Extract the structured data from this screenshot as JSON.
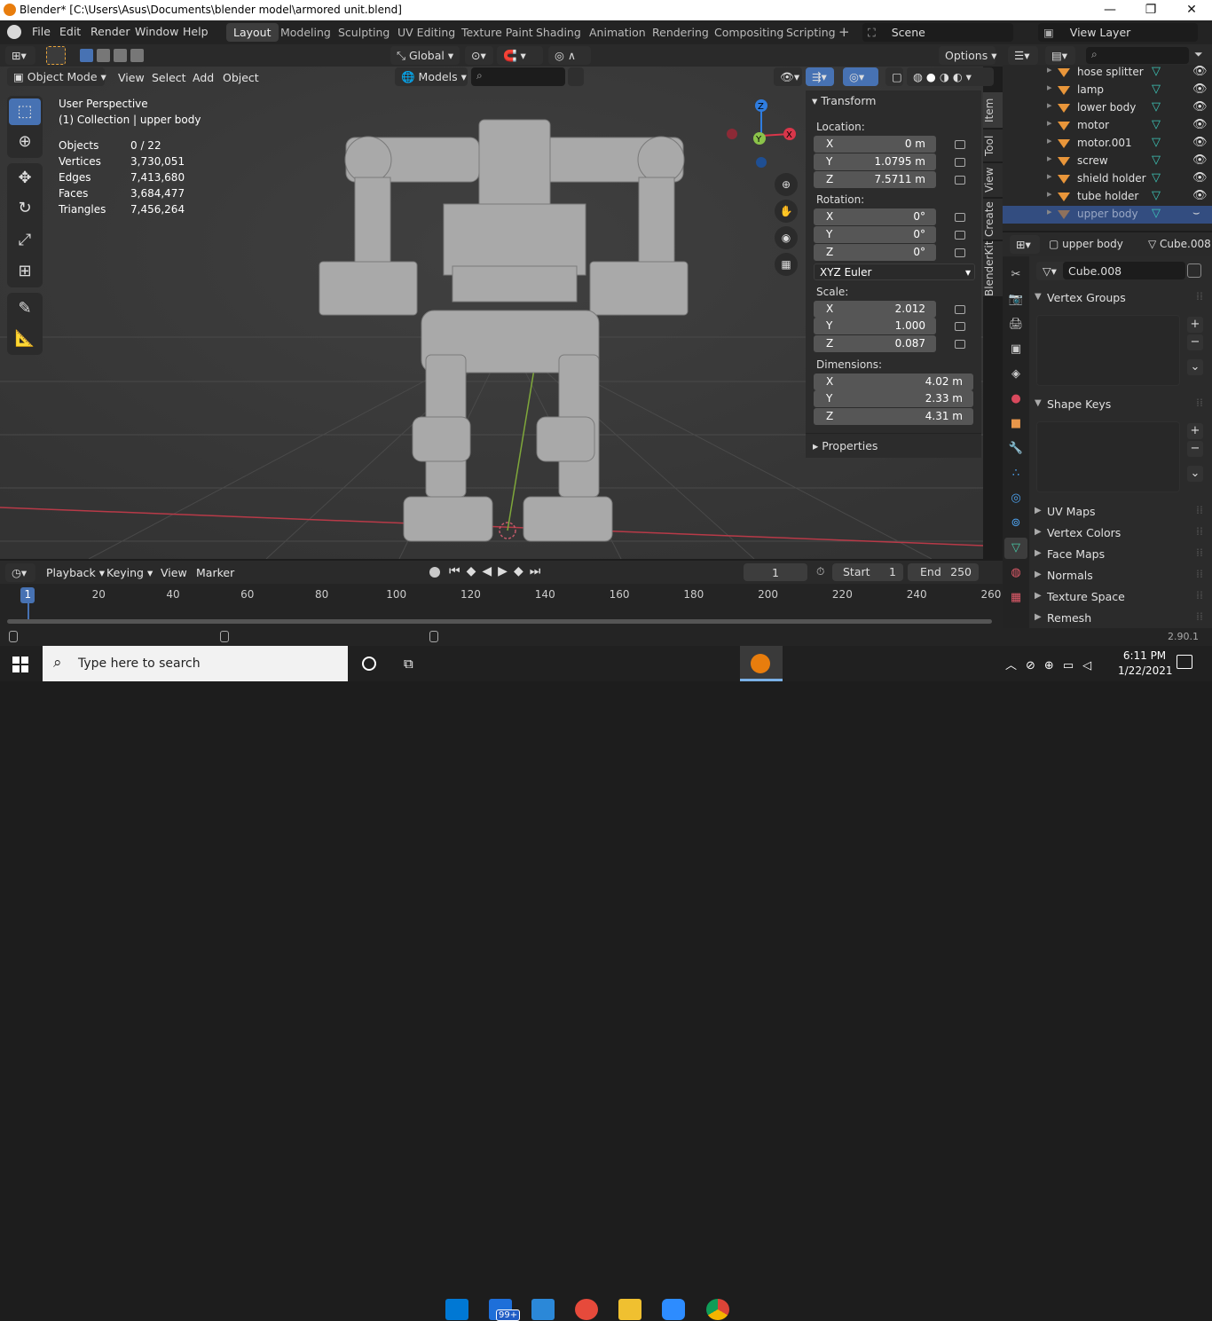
{
  "window": {
    "title": "Blender* [C:\\Users\\Asus\\Documents\\blender model\\armored unit.blend]",
    "minimize": "—",
    "maximize": "❐",
    "close": "✕"
  },
  "menus": [
    "File",
    "Edit",
    "Render",
    "Window",
    "Help"
  ],
  "workspaces": [
    "Layout",
    "Modeling",
    "Sculpting",
    "UV Editing",
    "Texture Paint",
    "Shading",
    "Animation",
    "Rendering",
    "Compositing",
    "Scripting"
  ],
  "scene": {
    "label": "Scene",
    "view_layer": "View Layer"
  },
  "viewport_header": {
    "options": "Options",
    "transform_orientation": "Global",
    "mode": "Object Mode",
    "view": "View",
    "select": "Select",
    "add": "Add",
    "object": "Object",
    "collection": "Models"
  },
  "viewport_info": {
    "perspective": "User Perspective",
    "collection": "(1) Collection | upper body"
  },
  "stats": [
    {
      "label": "Objects",
      "value": "0 / 22"
    },
    {
      "label": "Vertices",
      "value": "3,730,051"
    },
    {
      "label": "Edges",
      "value": "7,413,680"
    },
    {
      "label": "Faces",
      "value": "3,684,477"
    },
    {
      "label": "Triangles",
      "value": "7,456,264"
    }
  ],
  "n_panel": {
    "header": "Transform",
    "location_label": "Location:",
    "location": [
      {
        "axis": "X",
        "value": "0 m"
      },
      {
        "axis": "Y",
        "value": "1.0795 m"
      },
      {
        "axis": "Z",
        "value": "7.5711 m"
      }
    ],
    "rotation_label": "Rotation:",
    "rotation": [
      {
        "axis": "X",
        "value": "0°"
      },
      {
        "axis": "Y",
        "value": "0°"
      },
      {
        "axis": "Z",
        "value": "0°"
      }
    ],
    "rotation_mode": "XYZ Euler",
    "scale_label": "Scale:",
    "scale": [
      {
        "axis": "X",
        "value": "2.012"
      },
      {
        "axis": "Y",
        "value": "1.000"
      },
      {
        "axis": "Z",
        "value": "0.087"
      }
    ],
    "dimensions_label": "Dimensions:",
    "dimensions": [
      {
        "axis": "X",
        "value": "4.02 m"
      },
      {
        "axis": "Y",
        "value": "2.33 m"
      },
      {
        "axis": "Z",
        "value": "4.31 m"
      }
    ],
    "properties": "Properties",
    "tabs": [
      "Item",
      "Tool",
      "View",
      "Create",
      "BlenderKit"
    ]
  },
  "outliner": [
    "hose splitter",
    "lamp",
    "lower body",
    "motor",
    "motor.001",
    "screw",
    "shield holder",
    "tube holder",
    "upper body"
  ],
  "properties": {
    "object": "upper body",
    "mesh": "Cube.008",
    "datablock": "Cube.008",
    "sections": [
      "Vertex Groups",
      "Shape Keys",
      "UV Maps",
      "Vertex Colors",
      "Face Maps",
      "Normals",
      "Texture Space",
      "Remesh"
    ]
  },
  "timeline": {
    "playback": "Playback",
    "keying": "Keying",
    "view": "View",
    "marker": "Marker",
    "current_frame": "1",
    "start_label": "Start",
    "start": "1",
    "end_label": "End",
    "end": "250",
    "ticks": [
      "1",
      "20",
      "40",
      "60",
      "80",
      "100",
      "120",
      "140",
      "160",
      "180",
      "200",
      "220",
      "240",
      "260"
    ]
  },
  "status": {
    "version": "2.90.1"
  },
  "taskbar": {
    "search_placeholder": "Type here to search",
    "mail_badge": "99+",
    "time": "6:11 PM",
    "date": "1/22/2021"
  },
  "colors": {
    "accent": "#4772b3",
    "object_orange": "#e9963a",
    "viewport_bg": "#3a3a3a",
    "x_axis": "#d9364a",
    "y_axis": "#8bc34a",
    "z_axis": "#2f7de0"
  }
}
